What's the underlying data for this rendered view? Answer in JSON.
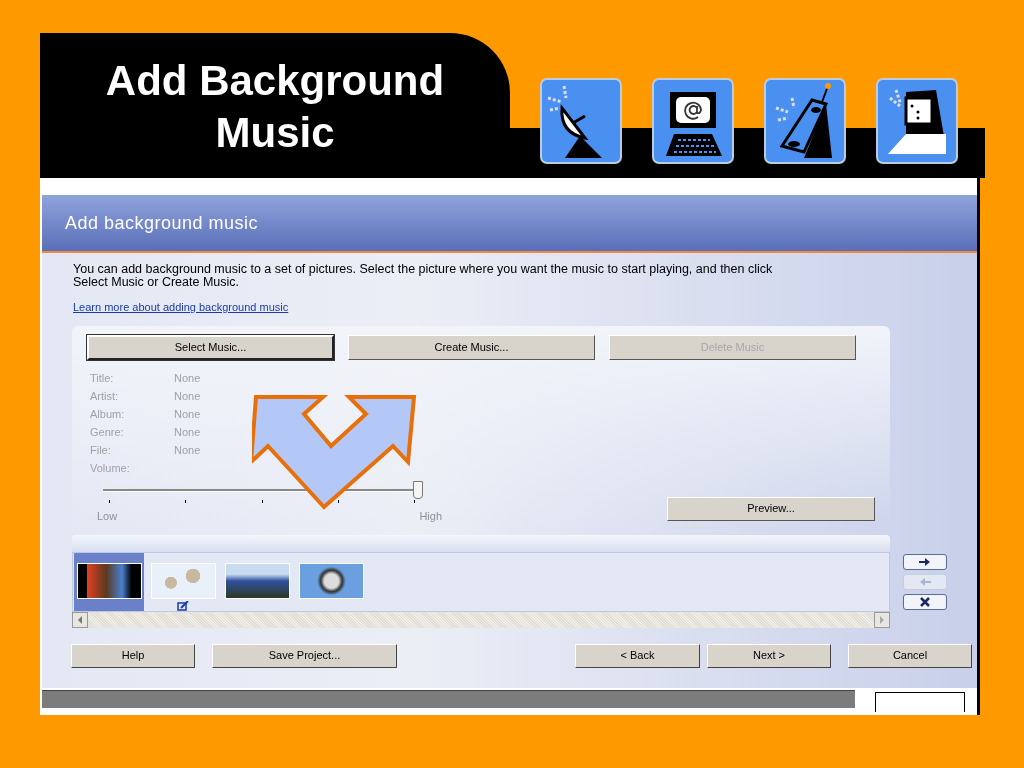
{
  "slide": {
    "title": "Add Background Music"
  },
  "dialog": {
    "title": "Add background music",
    "description": "You can add background music to a set of pictures.  Select the picture where you want the music to start playing, and then click Select Music or Create Music.",
    "link": "Learn more about adding background music",
    "music_buttons": [
      {
        "label": "Select Music...",
        "disabled": false,
        "focused": true
      },
      {
        "label": "Create Music...",
        "disabled": false,
        "focused": false
      },
      {
        "label": "Delete Music",
        "disabled": true,
        "focused": false
      }
    ],
    "details": {
      "disabled": true,
      "fields": [
        {
          "label": "Title:",
          "value": "None"
        },
        {
          "label": "Artist:",
          "value": "None"
        },
        {
          "label": "Album:",
          "value": "None"
        },
        {
          "label": "Genre:",
          "value": "None"
        },
        {
          "label": "File:",
          "value": "None"
        }
      ]
    },
    "volume": {
      "label": "Volume:",
      "level": 1.0,
      "min_label": "Low",
      "max_label": "High"
    },
    "preview_button": "Preview...",
    "filmstrip": [
      {
        "selected": true,
        "music_marker": false
      },
      {
        "selected": false,
        "music_marker": true
      },
      {
        "selected": false,
        "music_marker": false
      },
      {
        "selected": false,
        "music_marker": false
      }
    ],
    "strip_buttons": [
      {
        "kind": "move-right",
        "disabled": false
      },
      {
        "kind": "move-left",
        "disabled": true
      },
      {
        "kind": "remove",
        "disabled": false
      }
    ],
    "nav_buttons": [
      {
        "label": "Help"
      },
      {
        "label": "Save Project..."
      },
      {
        "label": "< Back"
      },
      {
        "label": "Next >"
      },
      {
        "label": "Cancel"
      }
    ]
  }
}
